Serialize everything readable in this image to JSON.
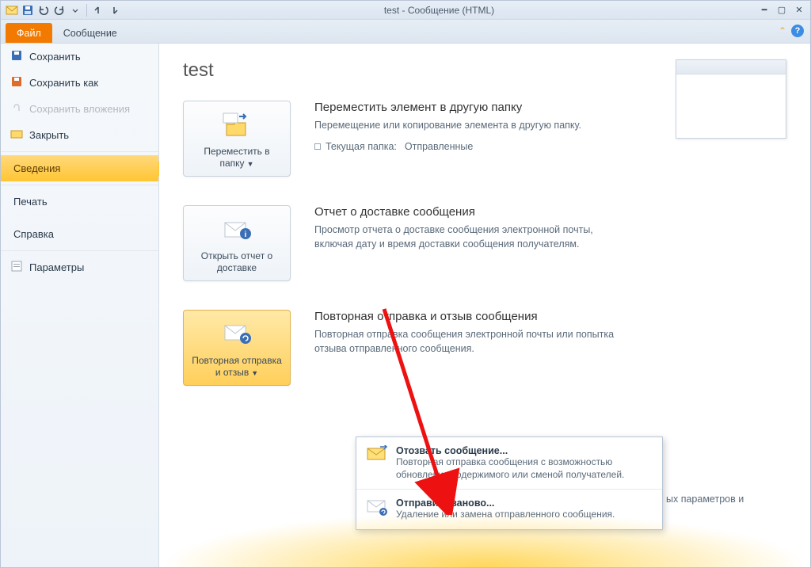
{
  "window": {
    "title": "test  -  Сообщение (HTML)"
  },
  "ribbon": {
    "file": "Файл",
    "message": "Сообщение"
  },
  "sidebar": {
    "save": "Сохранить",
    "save_as": "Сохранить как",
    "save_attachments": "Сохранить вложения",
    "close": "Закрыть",
    "info": "Сведения",
    "print": "Печать",
    "help": "Справка",
    "options": "Параметры"
  },
  "page": {
    "title": "test"
  },
  "sections": {
    "move": {
      "button": "Переместить в папку",
      "title": "Переместить элемент в другую папку",
      "desc": "Перемещение или копирование элемента в другую папку.",
      "current_label": "Текущая папка:",
      "current_value": "Отправленные"
    },
    "delivery": {
      "button": "Открыть отчет о доставке",
      "title": "Отчет о доставке сообщения",
      "desc": "Просмотр отчета о доставке сообщения электронной почты, включая дату и время доставки сообщения получателям."
    },
    "resend": {
      "button": "Повторная отправка и отзыв",
      "title": "Повторная отправка и отзыв сообщения",
      "desc": "Повторная отправка сообщения электронной почты или попытка отзыва отправленного сообщения."
    }
  },
  "menu": {
    "recall": {
      "title": "Отозвать сообщение...",
      "desc": "Повторная отправка сообщения с возможностью обновления содержимого или сменой получателей."
    },
    "resend": {
      "title": "Отправить заново...",
      "desc": "Удаление или замена отправленного сообщения."
    }
  },
  "truncated": "ых параметров и"
}
